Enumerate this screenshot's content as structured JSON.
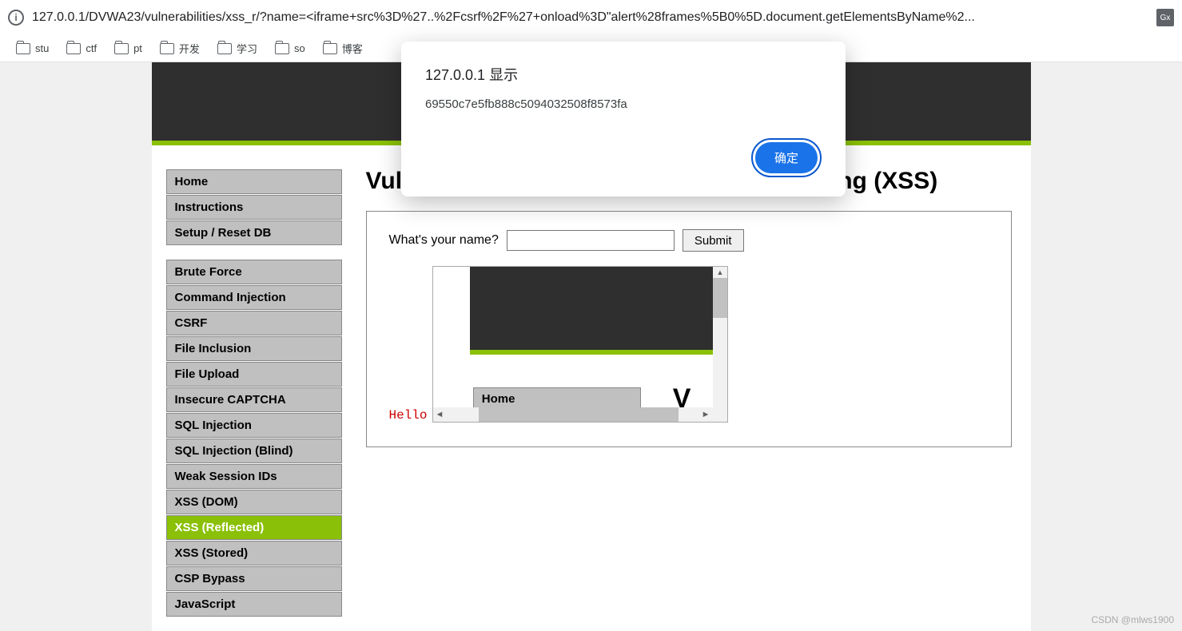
{
  "browser": {
    "url": "127.0.0.1/DVWA23/vulnerabilities/xss_r/?name=<iframe+src%3D%27..%2Fcsrf%2F%27+onload%3D\"alert%28frames%5B0%5D.document.getElementsByName%2...",
    "translate_label": "Gx"
  },
  "bookmarks": [
    {
      "label": "stu"
    },
    {
      "label": "ctf"
    },
    {
      "label": "pt"
    },
    {
      "label": "开发"
    },
    {
      "label": "学习"
    },
    {
      "label": "so"
    },
    {
      "label": "博客"
    }
  ],
  "dialog": {
    "title": "127.0.0.1 显示",
    "message": "69550c7e5fb888c5094032508f8573fa",
    "ok_label": "确定"
  },
  "sidebar": {
    "block1": [
      {
        "label": "Home"
      },
      {
        "label": "Instructions"
      },
      {
        "label": "Setup / Reset DB"
      }
    ],
    "block2": [
      {
        "label": "Brute Force"
      },
      {
        "label": "Command Injection"
      },
      {
        "label": "CSRF"
      },
      {
        "label": "File Inclusion"
      },
      {
        "label": "File Upload"
      },
      {
        "label": "Insecure CAPTCHA"
      },
      {
        "label": "SQL Injection"
      },
      {
        "label": "SQL Injection (Blind)"
      },
      {
        "label": "Weak Session IDs"
      },
      {
        "label": "XSS (DOM)"
      },
      {
        "label": "XSS (Reflected)",
        "active": true
      },
      {
        "label": "XSS (Stored)"
      },
      {
        "label": "CSP Bypass"
      },
      {
        "label": "JavaScript"
      }
    ]
  },
  "content": {
    "title": "Vulnerability: Reflected Cross Site Scripting (XSS)",
    "form_label": "What's your name?",
    "submit_label": "Submit",
    "hello_text": "Hello",
    "inner_menu_label": "Home",
    "inner_big_letter": "V"
  },
  "watermark": "CSDN @mlws1900"
}
